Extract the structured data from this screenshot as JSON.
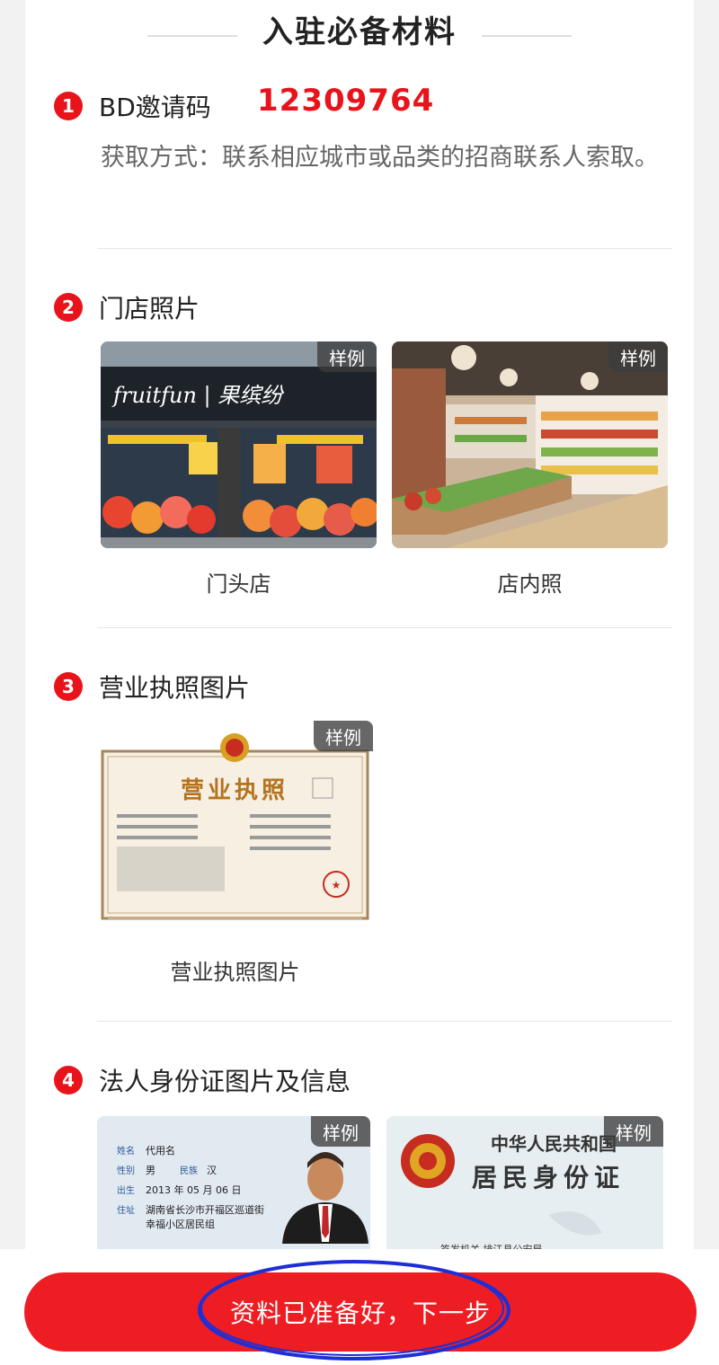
{
  "page": {
    "title": "入驻必备材料"
  },
  "sections": [
    {
      "num": "1",
      "title": "BD邀请码",
      "code": "12309764",
      "hint": "获取方式：联系相应城市或品类的招商联系人索取。"
    },
    {
      "num": "2",
      "title": "门店照片",
      "images": [
        {
          "tag": "样例",
          "caption": "门头店",
          "sign_text": "fruitfun | 果缤纷"
        },
        {
          "tag": "样例",
          "caption": "店内照"
        }
      ]
    },
    {
      "num": "3",
      "title": "营业执照图片",
      "images": [
        {
          "tag": "样例",
          "caption": "营业执照图片",
          "doc_title": "营业执照"
        }
      ]
    },
    {
      "num": "4",
      "title": "法人身份证图片及信息",
      "images": [
        {
          "tag": "样例",
          "fields": {
            "name_label": "姓名",
            "name": "代用名",
            "sex_label": "性别",
            "sex": "男",
            "ethnic_label": "民族",
            "ethnic": "汉",
            "birth_label": "出生",
            "birth": "2013 年 05 月 06 日",
            "addr_label": "住址",
            "addr1": "湖南省长沙市开福区巡道街",
            "addr2": "幸福小区居民组"
          }
        },
        {
          "tag": "样例",
          "country": "中华人民共和国",
          "card_title": "居民身份证",
          "issuer": "签发机关 排江县公安局"
        }
      ]
    }
  ],
  "footer": {
    "next_label": "资料已准备好，下一步"
  },
  "colors": {
    "accent": "#e8131b",
    "button": "#ee1d23",
    "annotation": "#1f2fd6"
  }
}
